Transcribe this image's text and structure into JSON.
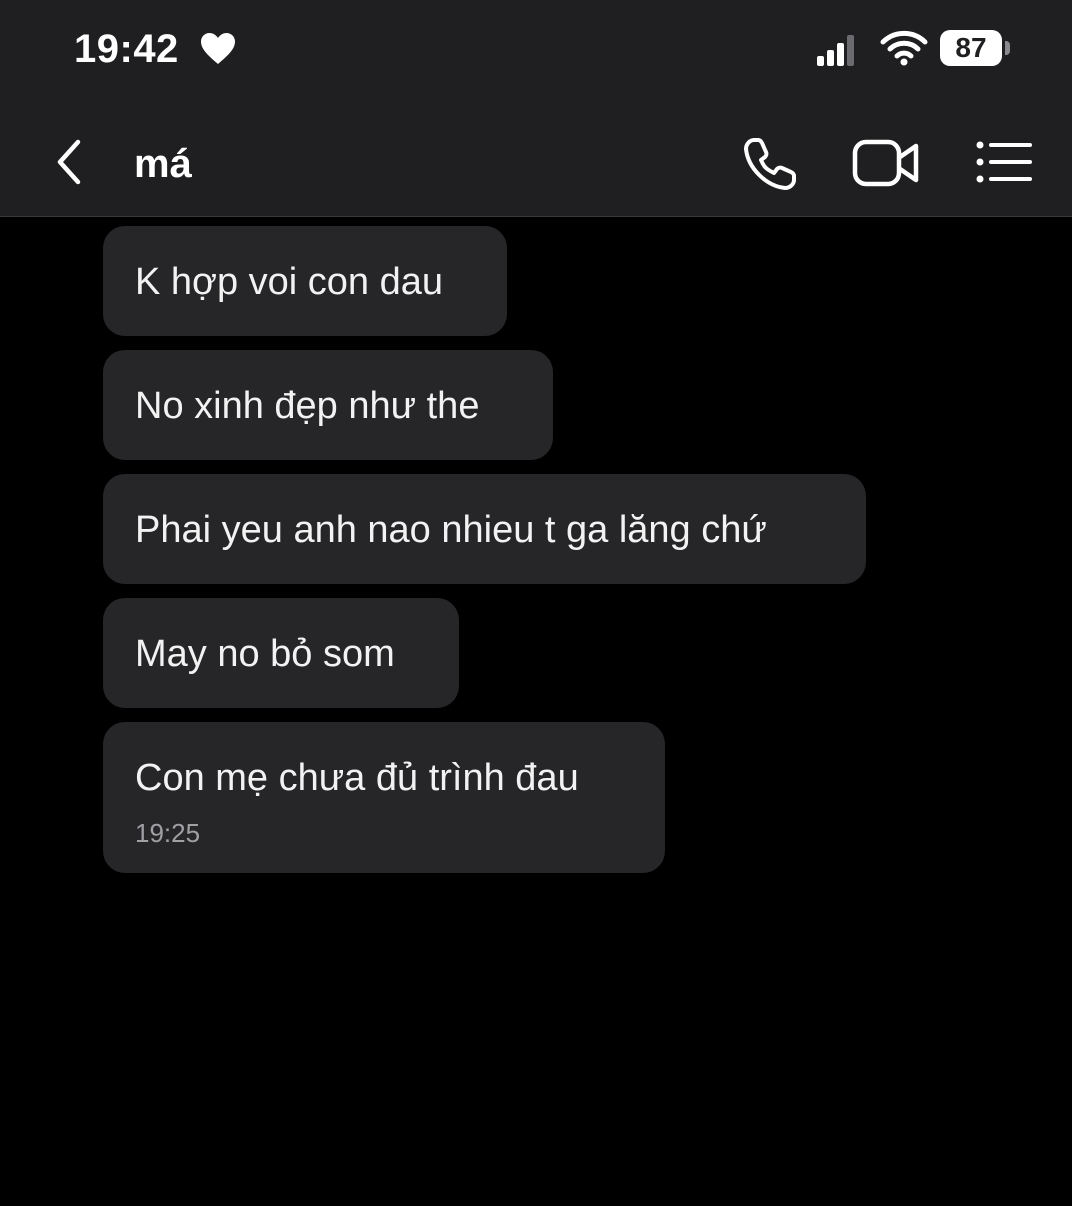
{
  "status_bar": {
    "time": "19:42",
    "battery": "87",
    "icons": [
      "heart-icon",
      "signal-icon",
      "wifi-icon",
      "battery-icon"
    ]
  },
  "header": {
    "contact_name": "má",
    "icons": [
      "back-icon",
      "phone-icon",
      "video-call-icon",
      "list-icon"
    ]
  },
  "messages": [
    {
      "text": "K hợp voi con dau"
    },
    {
      "text": "No xinh đẹp như the"
    },
    {
      "text": "Phai yeu anh nao nhieu t ga lăng chứ"
    },
    {
      "text": "May no bỏ som"
    },
    {
      "text": "Con mẹ chưa đủ trình đau",
      "time": "19:25"
    }
  ],
  "colors": {
    "background": "#000000",
    "topbar": "#1f1f21",
    "bubble": "#262628",
    "text": "#f2f2f2",
    "timestamp": "#a0a0a4"
  }
}
